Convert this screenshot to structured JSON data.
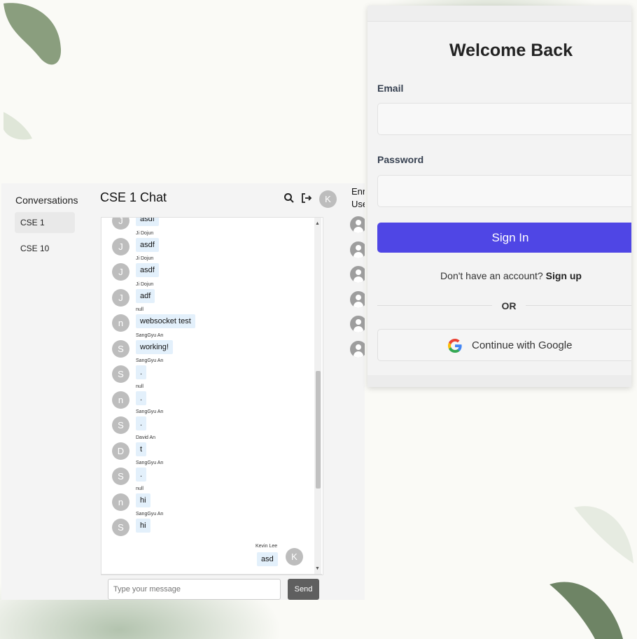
{
  "sidebar": {
    "title": "Conversations",
    "items": [
      {
        "label": "CSE 1"
      },
      {
        "label": "CSE 10"
      }
    ]
  },
  "chat": {
    "title": "CSE 1 Chat",
    "user_avatar": "K",
    "messages": [
      {
        "sender": "",
        "avatar": "J",
        "text": "asdf"
      },
      {
        "sender": "Ji Dojun",
        "avatar": "J",
        "text": "asdf"
      },
      {
        "sender": "Ji Dojun",
        "avatar": "J",
        "text": "asdf"
      },
      {
        "sender": "Ji Dojun",
        "avatar": "J",
        "text": "adf"
      },
      {
        "sender": "null",
        "avatar": "n",
        "text": "websocket test"
      },
      {
        "sender": "SangGyu An",
        "avatar": "S",
        "text": "working!"
      },
      {
        "sender": "SangGyu An",
        "avatar": "S",
        "text": "."
      },
      {
        "sender": "null",
        "avatar": "n",
        "text": "."
      },
      {
        "sender": "SangGyu An",
        "avatar": "S",
        "text": "."
      },
      {
        "sender": "David An",
        "avatar": "D",
        "text": "t"
      },
      {
        "sender": "SangGyu An",
        "avatar": "S",
        "text": "."
      },
      {
        "sender": "null",
        "avatar": "n",
        "text": "hi"
      },
      {
        "sender": "SangGyu An",
        "avatar": "S",
        "text": "hi"
      }
    ],
    "own_message": {
      "sender": "Kevin Lee",
      "avatar": "K",
      "text": "asd"
    },
    "input_placeholder": "Type your message",
    "send_label": "Send",
    "scroll_position": 0.65
  },
  "enrolled": {
    "title": "Enr\nUse",
    "user_count": 6
  },
  "login": {
    "title": "Welcome Back",
    "email_label": "Email",
    "password_label": "Password",
    "signin_label": "Sign In",
    "signup_prompt": "Don't have an account?",
    "signup_link": "Sign up",
    "or_label": "OR",
    "google_label": "Continue with Google",
    "accent_color": "#4f46e5"
  }
}
